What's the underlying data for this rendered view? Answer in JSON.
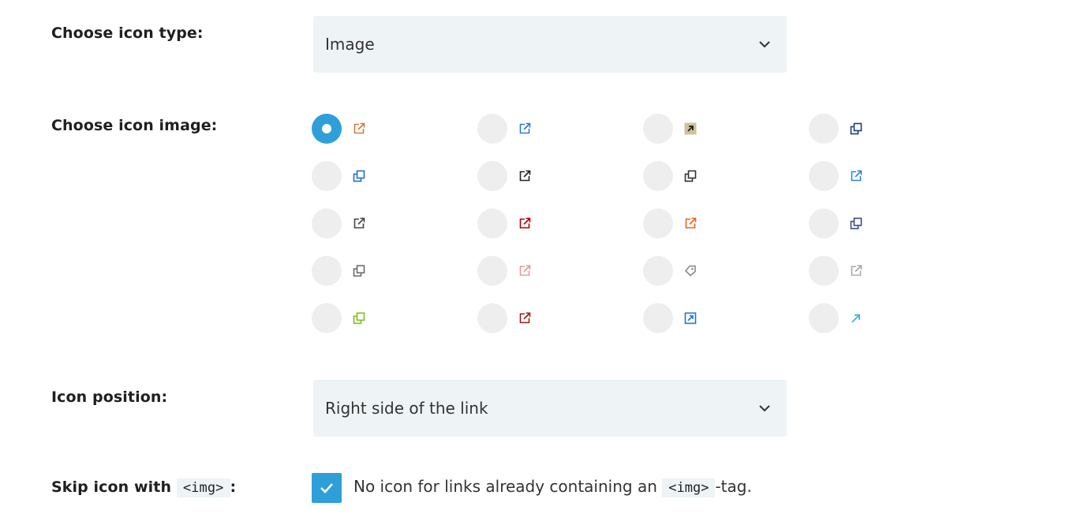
{
  "icon_type": {
    "label": "Choose icon type:",
    "selected": "Image"
  },
  "icon_image": {
    "label": "Choose icon image:",
    "selected_index": 0,
    "options": [
      {
        "icon": "external-link-multicolor-icon",
        "color": "#c9813a"
      },
      {
        "icon": "external-link-blue-arrow-icon",
        "color": "#2a7fd4"
      },
      {
        "icon": "arrow-tan-box-icon",
        "color": "#b8a25a"
      },
      {
        "icon": "double-window-navy-icon",
        "color": "#1b3e8a"
      },
      {
        "icon": "double-window-blue-icon",
        "color": "#1d6fd0"
      },
      {
        "icon": "external-link-black-icon",
        "color": "#222222"
      },
      {
        "icon": "double-window-dark-icon",
        "color": "#333333"
      },
      {
        "icon": "external-link-blue-box-icon",
        "color": "#2a86d9"
      },
      {
        "icon": "external-link-gray-icon",
        "color": "#444444"
      },
      {
        "icon": "external-link-red-arrow-icon",
        "color": "#b00000"
      },
      {
        "icon": "external-link-orange-icon",
        "color": "#e8641e"
      },
      {
        "icon": "window-stack-slate-icon",
        "color": "#3d4c8a"
      },
      {
        "icon": "double-window-gray-icon",
        "color": "#6b6b6b"
      },
      {
        "icon": "external-link-pink-icon",
        "color": "#e59a9a"
      },
      {
        "icon": "tag-gray-icon",
        "color": "#8a8a8a"
      },
      {
        "icon": "external-link-lightgray-icon",
        "color": "#a8a8a8"
      },
      {
        "icon": "double-window-green-icon",
        "color": "#7cbf1e"
      },
      {
        "icon": "external-link-darkred-icon",
        "color": "#9e1b1b"
      },
      {
        "icon": "box-arrow-blue-icon",
        "color": "#1f78c8"
      },
      {
        "icon": "arrow-cyan-icon",
        "color": "#3bb3cf"
      }
    ]
  },
  "icon_position": {
    "label": "Icon position:",
    "selected": "Right side of the link"
  },
  "skip_icon": {
    "label_prefix": "Skip icon with",
    "label_code": "<img>",
    "label_suffix": ":",
    "checked": true,
    "text_prefix": "No icon for links already containing an",
    "text_code": "<img>",
    "text_suffix": "-tag."
  },
  "colors": {
    "accent": "#2e9fd8",
    "field_bg": "#eef3f5",
    "radio_bg": "#eeeeee"
  }
}
